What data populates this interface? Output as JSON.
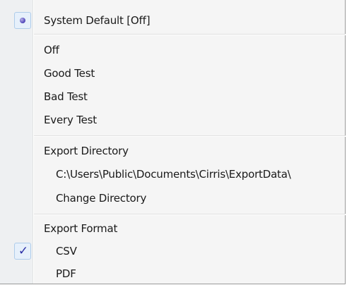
{
  "menu": {
    "system_default": {
      "label": "System Default [Off]",
      "selected": true
    },
    "modes": [
      {
        "label": "Off"
      },
      {
        "label": "Good Test"
      },
      {
        "label": "Bad Test"
      },
      {
        "label": "Every Test"
      }
    ],
    "export_directory": {
      "header": "Export Directory",
      "path": "C:\\Users\\Public\\Documents\\Cirris\\ExportData\\",
      "change_label": "Change Directory"
    },
    "export_format": {
      "header": "Export Format",
      "options": [
        {
          "label": "CSV",
          "checked": true
        },
        {
          "label": "PDF",
          "checked": false
        }
      ]
    }
  },
  "colors": {
    "gutter": "#eef0f2",
    "menu_background": "#f5f5f5",
    "check_highlight": "#e6f0fb",
    "check_border": "#aeccea",
    "check_mark": "#2c2fa6"
  },
  "icons": {
    "radio": "radio-bullet-icon",
    "check": "checkmark-icon"
  }
}
